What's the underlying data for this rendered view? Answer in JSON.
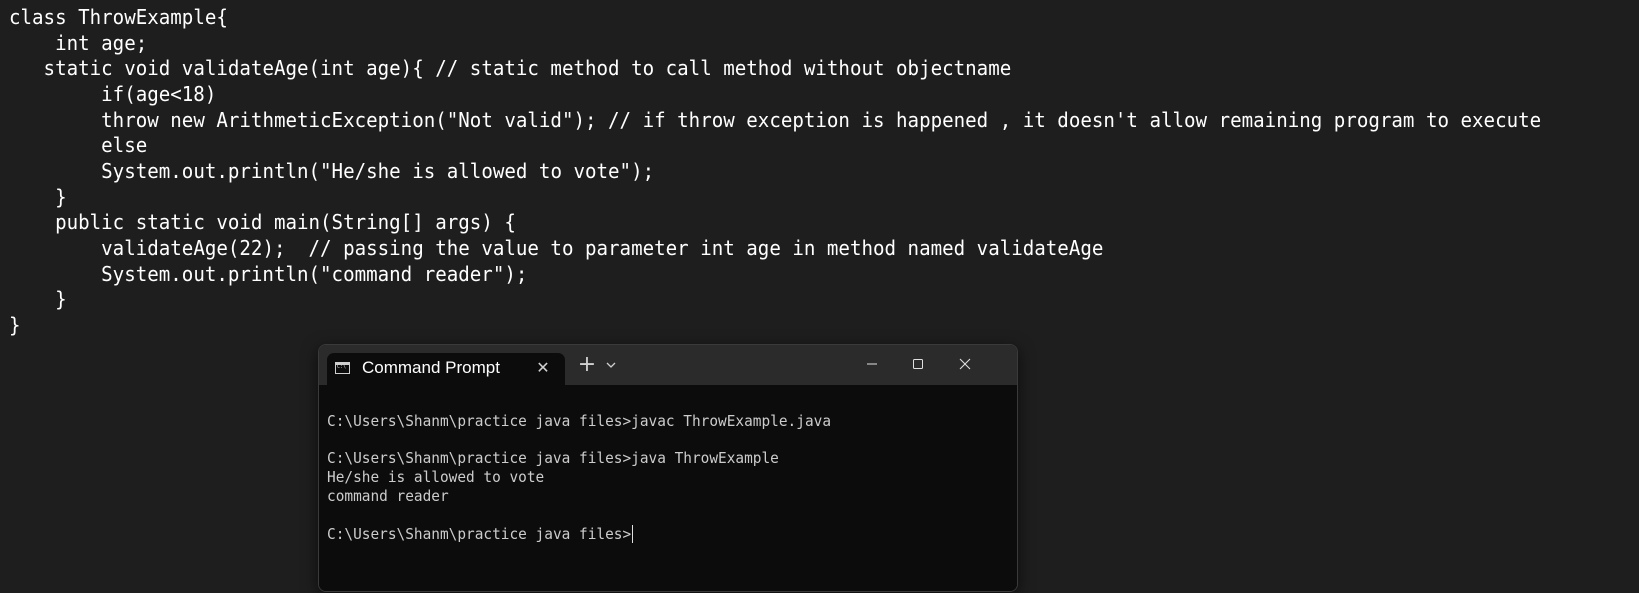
{
  "code": {
    "lines": [
      "class ThrowExample{",
      "    int age;",
      "   static void validateAge(int age){ // static method to call method without objectname",
      "        if(age<18)",
      "        throw new ArithmeticException(\"Not valid\"); // if throw exception is happened , it doesn't allow remaining program to execute",
      "        else",
      "        System.out.println(\"He/she is allowed to vote\");",
      "    }",
      "    public static void main(String[] args) {",
      "        validateAge(22);  // passing the value to parameter int age in method named validateAge",
      "        System.out.println(\"command reader\");",
      "    }",
      "}"
    ]
  },
  "terminal_window": {
    "tab_title": "Command Prompt",
    "tab_icon": "cmd-icon",
    "close_tab_icon": "close-icon",
    "new_tab_icon": "plus-icon",
    "dropdown_icon": "chevron-down-icon",
    "minimize_icon": "minimize-icon",
    "maximize_icon": "maximize-icon",
    "close_window_icon": "close-icon",
    "output_lines": [
      "C:\\Users\\Shanm\\practice java files>javac ThrowExample.java",
      "",
      "C:\\Users\\Shanm\\practice java files>java ThrowExample",
      "He/she is allowed to vote",
      "command reader",
      "",
      "C:\\Users\\Shanm\\practice java files>"
    ]
  },
  "colors": {
    "editor_background": "#1e1e1e",
    "editor_text": "#ffffff",
    "terminal_background": "#0c0c0c",
    "terminal_text": "#cccccc",
    "titlebar_background": "#2b2b2b"
  }
}
